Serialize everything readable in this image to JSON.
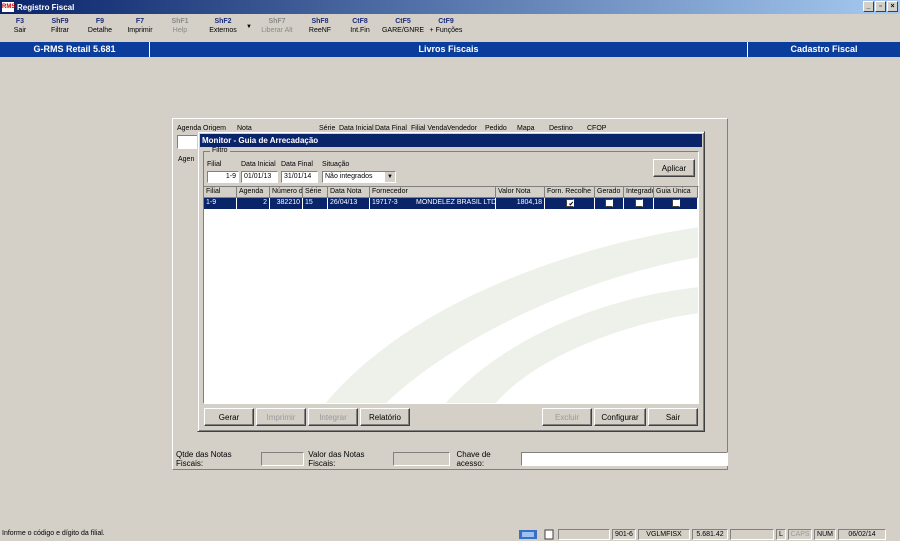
{
  "window": {
    "title": "Registro Fiscal",
    "app_icon": "rms-logo-icon"
  },
  "toolbar": {
    "items": [
      {
        "key": "F3",
        "label": "Sair",
        "enabled": true
      },
      {
        "key": "ShF9",
        "label": "Filtrar",
        "enabled": true
      },
      {
        "key": "F9",
        "label": "Detalhe",
        "enabled": true
      },
      {
        "key": "F7",
        "label": "Imprimir",
        "enabled": true
      },
      {
        "key": "ShF1",
        "label": "Help",
        "enabled": false
      },
      {
        "key": "ShF2",
        "label": "Externos",
        "enabled": true
      },
      {
        "key": "ShF7",
        "label": "Liberar Alt",
        "enabled": false
      },
      {
        "key": "ShF8",
        "label": "ReeNF",
        "enabled": true
      },
      {
        "key": "CtF8",
        "label": "Int.Fin",
        "enabled": true
      },
      {
        "key": "CtF5",
        "label": "GARE/GNRE",
        "enabled": true
      },
      {
        "key": "CtF9",
        "label": "+ Funções",
        "enabled": true
      }
    ]
  },
  "header": {
    "left": "G-RMS Retail 5.681",
    "center": "Livros Fiscais",
    "right": "Cadastro Fiscal"
  },
  "background_form": {
    "columns": [
      "Agenda",
      "Origem",
      "Nota",
      "Série",
      "Data Inicial",
      "Data Final",
      "Filial Venda",
      "Vendedor",
      "Pedido",
      "Mapa",
      "Destino",
      "CFOP"
    ],
    "side_label": "Agen",
    "qtde_label": "Qtde das Notas Fiscais:",
    "valor_label": "Valor  das Notas Fiscais:",
    "chave_label": "Chave de acesso:"
  },
  "dialog": {
    "title": "Monitor - Guia de Arrecadação",
    "filter_legend": "Filtro",
    "filial_label": "Filial",
    "filial_value": "1-9",
    "data_inicial_label": "Data Inicial",
    "data_inicial_value": "01/01/13",
    "data_final_label": "Data Final",
    "data_final_value": "31/01/14",
    "situacao_label": "Situação",
    "situacao_value": "Não integrados",
    "aplicar_label": "Aplicar",
    "grid_headers": [
      "Filial",
      "Agenda",
      "Número di",
      "Série",
      "Data Nota",
      "Fornecedor",
      "",
      "Valor Nota",
      "Forn. Recolhe",
      "Gerado",
      "Integrado",
      "Guia Única"
    ],
    "rows": [
      {
        "filial": "1-9",
        "agenda": "2",
        "numero": "382210",
        "serie": "15",
        "data_nota": "26/04/13",
        "fornecedor_codigo": "19717-3",
        "fornecedor_nome": "MONDELEZ BRASIL LTDA",
        "valor_nota": "1804,18",
        "forn_recolhe": true,
        "gerado": false,
        "integrado": false,
        "guia_unica": false
      }
    ],
    "buttons": {
      "gerar": "Gerar",
      "imprimir": "Imprimir",
      "integrar": "Integrar",
      "relatorio": "Relatório",
      "excluir": "Excluir",
      "configurar": "Configurar",
      "sair": "Sair"
    }
  },
  "status_bar": {
    "message": "Informe o código e dígito da filial.",
    "panel_1": "901-6",
    "panel_2": "VGLMFISX",
    "panel_3": "5.681.42",
    "panel_4": "L",
    "caps": "CAPS",
    "num": "NUM",
    "date": "06/02/14"
  }
}
